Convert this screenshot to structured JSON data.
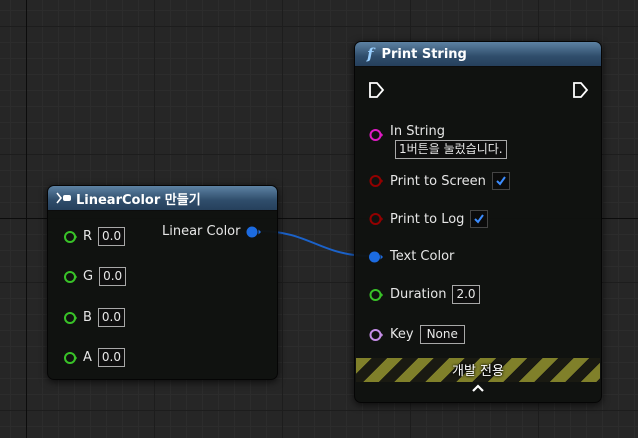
{
  "linear_color_node": {
    "title": "LinearColor 만들기",
    "inputs": [
      {
        "label": "R",
        "value": "0.0"
      },
      {
        "label": "G",
        "value": "0.0"
      },
      {
        "label": "B",
        "value": "0.0"
      },
      {
        "label": "A",
        "value": "0.0"
      }
    ],
    "output_label": "Linear Color"
  },
  "print_string_node": {
    "title_icon": "f",
    "title": "Print String",
    "in_string_label": "In String",
    "in_string_value": "1버튼을 눌렀습니다.",
    "print_to_screen_label": "Print to Screen",
    "print_to_screen_checked": true,
    "print_to_log_label": "Print to Log",
    "print_to_log_checked": true,
    "text_color_label": "Text Color",
    "duration_label": "Duration",
    "duration_value": "2.0",
    "key_label": "Key",
    "key_value": "None",
    "dev_only_label": "개발 전용",
    "collapse_glyph": "^"
  },
  "colors": {
    "float_pin": "#39c228",
    "string_pin": "#e01bc5",
    "bool_pin": "#930000",
    "struct_pin": "#1c6be0",
    "name_pin": "#c68ee8",
    "header": "#2f4d6b"
  }
}
